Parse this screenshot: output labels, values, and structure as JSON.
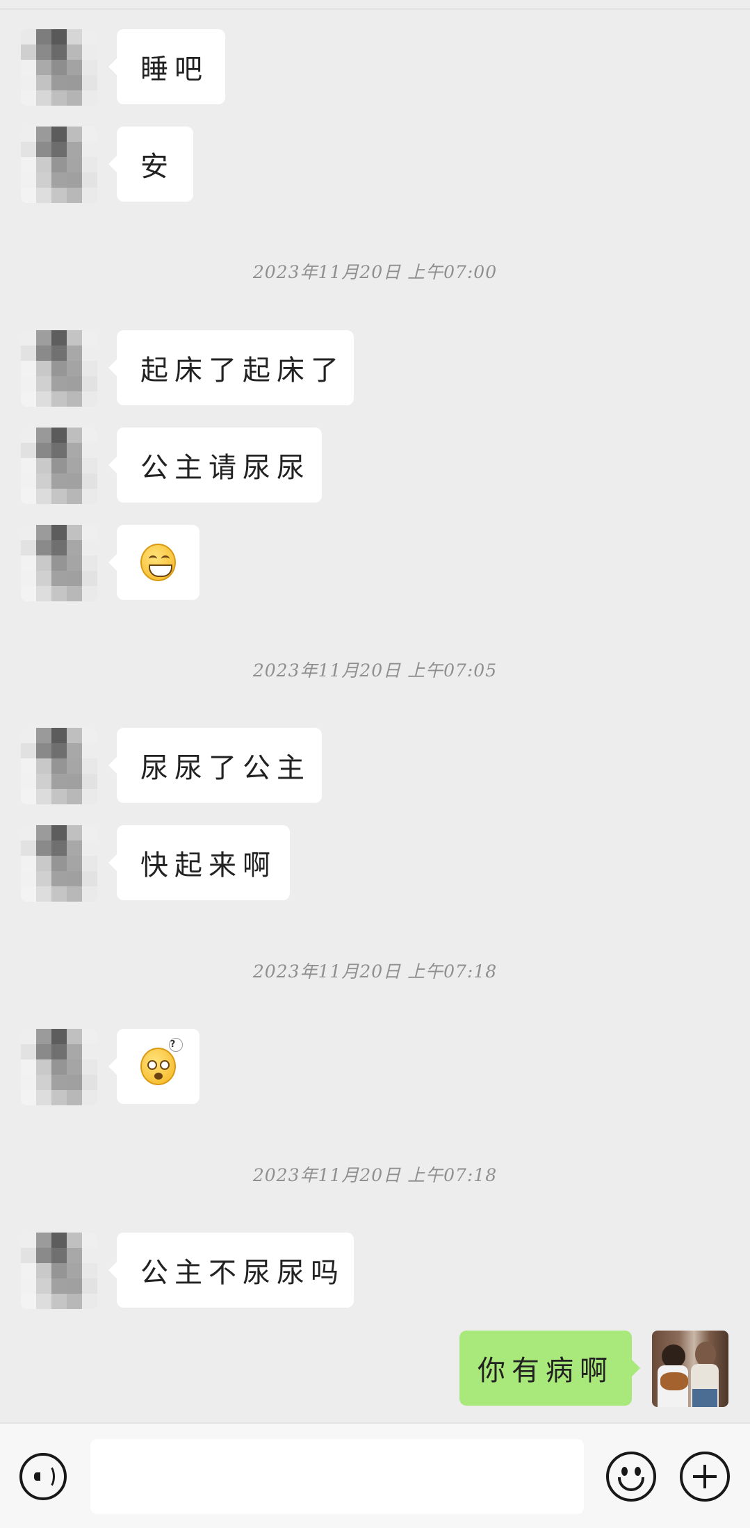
{
  "chat": {
    "messages": [
      {
        "text": "睡吧"
      },
      {
        "text": "安"
      },
      {
        "text": "起床了起床了"
      },
      {
        "text": "公主请尿尿"
      },
      {
        "emoji": "grinning-squint-emoji"
      },
      {
        "text": "尿尿了公主"
      },
      {
        "text": "快起来啊"
      },
      {
        "emoji": "confused-question-emoji"
      },
      {
        "text": "公主不尿尿吗"
      }
    ],
    "timestamps": [
      "2023年11月20日 上午07:00",
      "2023年11月20日 上午07:05",
      "2023年11月20日 上午07:18",
      "2023年11月20日 上午07:18"
    ],
    "self_message": {
      "text": "你有病啊"
    }
  },
  "bottom_bar": {
    "voice_icon": "voice-input-icon",
    "input_value": "",
    "emoji_icon": "emoji-icon",
    "plus_icon": "plus-icon"
  },
  "colors": {
    "background": "#ededed",
    "incoming_bubble": "#ffffff",
    "outgoing_bubble": "#a9e87a",
    "timestamp": "#8f8f8f"
  }
}
